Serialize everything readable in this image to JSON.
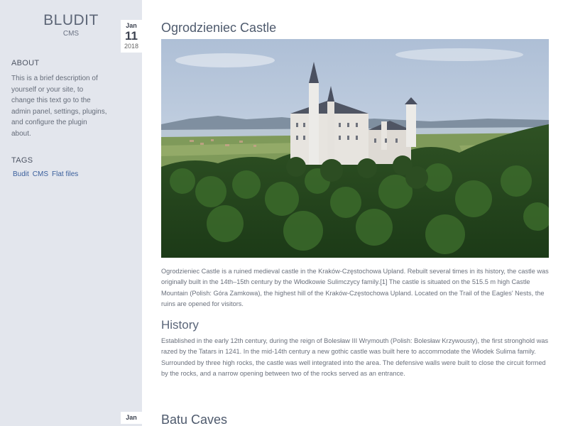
{
  "site": {
    "title": "BLUDIT",
    "subtitle": "CMS"
  },
  "sidebar": {
    "about_heading": "ABOUT",
    "about_text": "This is a brief description of yourself or your site, to change this text go to the admin panel, settings, plugins, and configure the plugin about.",
    "tags_heading": "TAGS",
    "tags": [
      "Budit",
      "CMS",
      "Flat files"
    ]
  },
  "posts": [
    {
      "date": {
        "month": "Jan",
        "day": "11",
        "year": "2018"
      },
      "title": "Ogrodzieniec Castle",
      "intro": "Ogrodzieniec Castle is a ruined medieval castle in the Kraków-Częstochowa Upland. Rebuilt several times in its history, the castle was originally built in the 14th–15th century by the Włodkowie Sulimczycy family.[1] The castle is situated on the 515.5 m high Castle Mountain (Polish: Góra Zamkowa), the highest hill of the Kraków-Częstochowa Upland. Located on the Trail of the Eagles' Nests, the ruins are opened for visitors.",
      "section_heading": "History",
      "section_text": "Established in the early 12th century, during the reign of Bolesław III Wrymouth (Polish: Bolesław Krzywousty), the first stronghold was razed by the Tatars in 1241. In the mid-14th century a new gothic castle was built here to accommodate the Włodek Sulima family. Surrounded by three high rocks, the castle was well integrated into the area. The defensive walls were built to close the circuit formed by the rocks, and a narrow opening between two of the rocks served as an entrance."
    },
    {
      "date": {
        "month": "Jan"
      },
      "title": "Batu Caves"
    }
  ]
}
